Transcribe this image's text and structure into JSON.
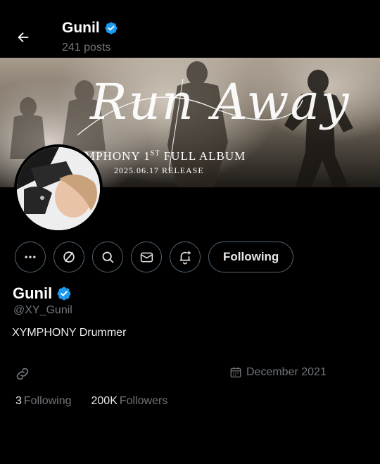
{
  "header": {
    "name": "Gunil",
    "posts": "241 posts"
  },
  "banner": {
    "script_text": "Run Away",
    "album_text": "XYMPHONY 1ST FULL ALBUM",
    "album_visible": "MPHONY 1",
    "album_sup": "ST",
    "album_rest": " FULL ALBUM",
    "release_text": "2025.06.17 RELEASE"
  },
  "actions": {
    "icons": [
      "more-icon",
      "grok-icon",
      "search-icon",
      "message-icon",
      "notification-bell-icon"
    ],
    "following_label": "Following"
  },
  "profile": {
    "name": "Gunil",
    "handle": "@XY_Gunil",
    "bio": "XYMPHONY Drummer",
    "joined": "December 2021"
  },
  "stats": {
    "following_count": "3",
    "following_label": "Following",
    "followers_count": "200K",
    "followers_label": "Followers"
  },
  "colors": {
    "background": "#000000",
    "text": "#e7e9ea",
    "muted": "#71767b",
    "verified": "#1d9bf0",
    "border": "#536471"
  }
}
